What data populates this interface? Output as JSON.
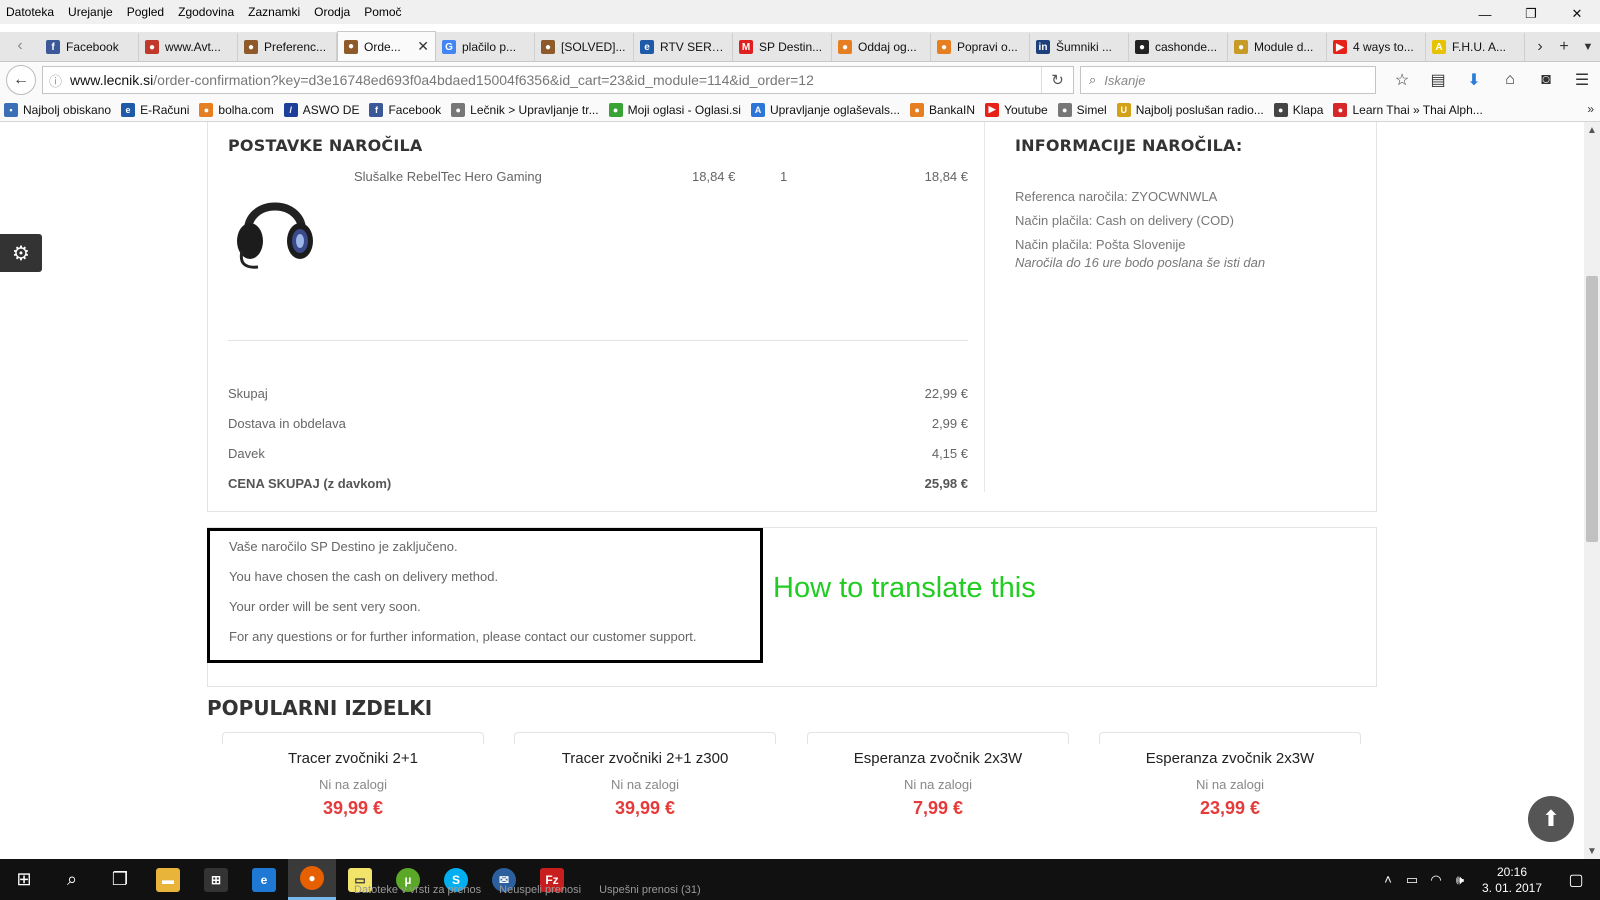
{
  "menubar": {
    "items": [
      "Datoteka",
      "Urejanje",
      "Pogled",
      "Zgodovina",
      "Zaznamki",
      "Orodja",
      "Pomoč"
    ]
  },
  "window_controls": {
    "minimize": "—",
    "restore": "❐",
    "close": "✕"
  },
  "tabs": [
    {
      "label": "Facebook",
      "fav": "f",
      "color": "#3b5998"
    },
    {
      "label": "www.Avt...",
      "fav": "●",
      "color": "#c0392b"
    },
    {
      "label": "Preferenc...",
      "fav": "●",
      "color": "#8e5a2a"
    },
    {
      "label": "Orde...",
      "fav": "●",
      "color": "#8e5a2a",
      "active": true
    },
    {
      "label": "plačilo p...",
      "fav": "G",
      "color": "#4285f4"
    },
    {
      "label": "[SOLVED]...",
      "fav": "●",
      "color": "#8e5a2a"
    },
    {
      "label": "RTV SERV...",
      "fav": "e",
      "color": "#1e5aa8"
    },
    {
      "label": "SP Destin...",
      "fav": "M",
      "color": "#e02020"
    },
    {
      "label": "Oddaj og...",
      "fav": "●",
      "color": "#e67e22"
    },
    {
      "label": "Popravi o...",
      "fav": "●",
      "color": "#e67e22"
    },
    {
      "label": "Šumniki ...",
      "fav": "in",
      "color": "#1d3f7a"
    },
    {
      "label": "cashonde...",
      "fav": "●",
      "color": "#222222"
    },
    {
      "label": "Module d...",
      "fav": "●",
      "color": "#c79b28"
    },
    {
      "label": "4 ways to...",
      "fav": "▶",
      "color": "#e62117"
    },
    {
      "label": "F.H.U. A...",
      "fav": "A",
      "color": "#e6c300"
    }
  ],
  "navbar": {
    "url_host": "www.lecnik.si",
    "url_path": "/order-confirmation?key=d3e16748ed693f0a4bdaed15004f6356&id_cart=23&id_module=114&id_order=12",
    "search_placeholder": "Iskanje"
  },
  "bookmarks": [
    {
      "label": "Najbolj obiskano",
      "color": "#3b6fb6",
      "fav": "▪"
    },
    {
      "label": "E-Računi",
      "color": "#1e5aa8",
      "fav": "e"
    },
    {
      "label": "bolha.com",
      "color": "#e67e22",
      "fav": "●"
    },
    {
      "label": "ASWO DE",
      "color": "#1d3f9a",
      "fav": "/"
    },
    {
      "label": "Facebook",
      "color": "#3b5998",
      "fav": "f"
    },
    {
      "label": "Lečnik > Upravljanje tr...",
      "color": "#777777",
      "fav": "●"
    },
    {
      "label": "Moji oglasi - Oglasi.si",
      "color": "#3aa335",
      "fav": "●"
    },
    {
      "label": "Upravljanje oglaševals...",
      "color": "#2d76d8",
      "fav": "A"
    },
    {
      "label": "BankaIN",
      "color": "#e67e22",
      "fav": "●"
    },
    {
      "label": "Youtube",
      "color": "#e62117",
      "fav": "▶"
    },
    {
      "label": "Simel",
      "color": "#777777",
      "fav": "●"
    },
    {
      "label": "Najbolj poslušan radio...",
      "color": "#d4a017",
      "fav": "U"
    },
    {
      "label": "Klapa",
      "color": "#444444",
      "fav": "●"
    },
    {
      "label": "Learn Thai » Thai Alph...",
      "color": "#d62828",
      "fav": "●"
    }
  ],
  "order": {
    "items_title": "POSTAVKE NAROČILA",
    "product": {
      "name": "Slušalke RebelTec Hero Gaming",
      "unit_price": "18,84 €",
      "qty": "1",
      "total": "18,84 €"
    },
    "totals": [
      {
        "label": "Skupaj",
        "value": "22,99 €"
      },
      {
        "label": "Dostava in obdelava",
        "value": "2,99 €"
      },
      {
        "label": "Davek",
        "value": "4,15 €"
      },
      {
        "label": "CENA SKUPAJ (z davkom)",
        "value": "25,98 €",
        "bold": true
      }
    ],
    "info_title": "INFORMACIJE NAROČILA:",
    "info": {
      "reference": "Referenca naročila: ZYOCWNWLA",
      "payment": "Način plačila: Cash on delivery (COD)",
      "shipping": "Način plačila: Pošta Slovenije",
      "shipping_note": "Naročila do 16 ure bodo poslana še isti dan"
    }
  },
  "confirmation": {
    "lines": [
      "Vaše naročilo SP Destino je zaključeno.",
      "You have chosen the cash on delivery method.",
      "Your order will be sent very soon.",
      "For any questions or for further information, please contact our customer support."
    ],
    "annotation": "How to translate this",
    "annotation_color": "#22cc22"
  },
  "popular": {
    "title": "POPULARNI IZDELKI",
    "products": [
      {
        "name": "Tracer zvočniki 2+1",
        "stock": "Ni na zalogi",
        "price": "39,99 €"
      },
      {
        "name": "Tracer zvočniki 2+1 z300",
        "stock": "Ni na zalogi",
        "price": "39,99 €"
      },
      {
        "name": "Esperanza zvočnik 2x3W",
        "stock": "Ni na zalogi",
        "price": "7,99 €"
      },
      {
        "name": "Esperanza zvočnik 2x3W",
        "stock": "Ni na zalogi",
        "price": "23,99 €"
      }
    ],
    "price_color": "#e53b3b"
  },
  "taskbar": {
    "downloads": [
      "Datoteke v vrsti za prenos",
      "Neuspeli prenosi",
      "Uspešni prenosi (31)"
    ],
    "time": "20:16",
    "date": "3. 01. 2017"
  }
}
